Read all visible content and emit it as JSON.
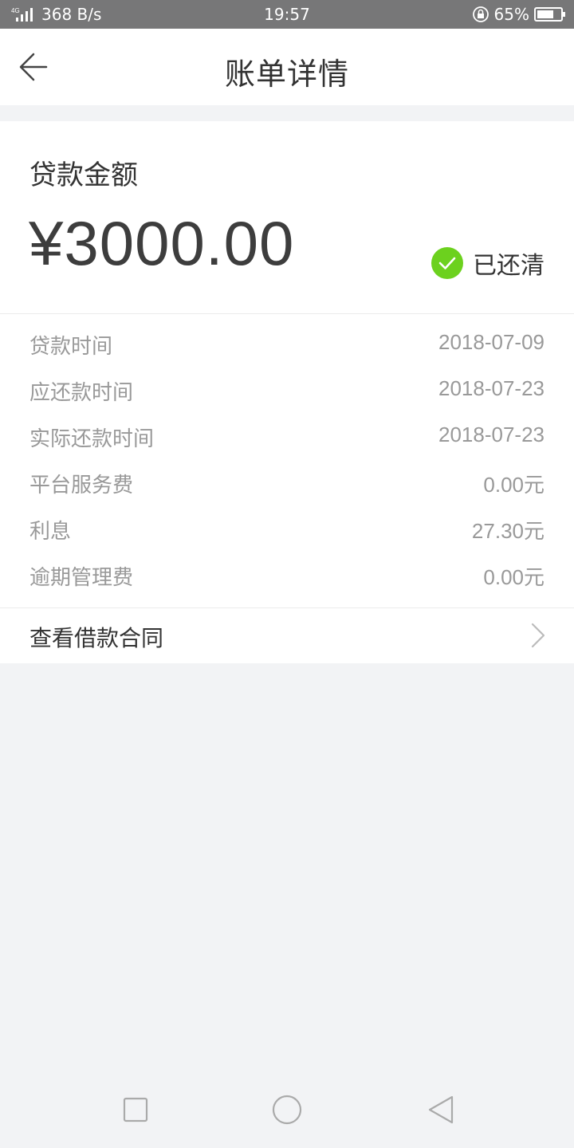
{
  "status_bar": {
    "network_type": "4G",
    "speed": "368 B/s",
    "time": "19:57",
    "battery": "65%"
  },
  "header": {
    "title": "账单详情",
    "back_icon": "arrow-left-icon"
  },
  "loan": {
    "label": "贷款金额",
    "amount": "¥3000.00",
    "status": "已还清",
    "status_color": "#6cd11e"
  },
  "details": [
    {
      "label": "贷款时间",
      "value": "2018-07-09"
    },
    {
      "label": "应还款时间",
      "value": "2018-07-23"
    },
    {
      "label": "实际还款时间",
      "value": "2018-07-23"
    },
    {
      "label": "平台服务费",
      "value": "0.00元"
    },
    {
      "label": "利息",
      "value": "27.30元"
    },
    {
      "label": "逾期管理费",
      "value": "0.00元"
    }
  ],
  "contract": {
    "label": "查看借款合同"
  },
  "nav": {
    "recent_icon": "square-icon",
    "home_icon": "circle-icon",
    "back_icon": "triangle-back-icon"
  }
}
